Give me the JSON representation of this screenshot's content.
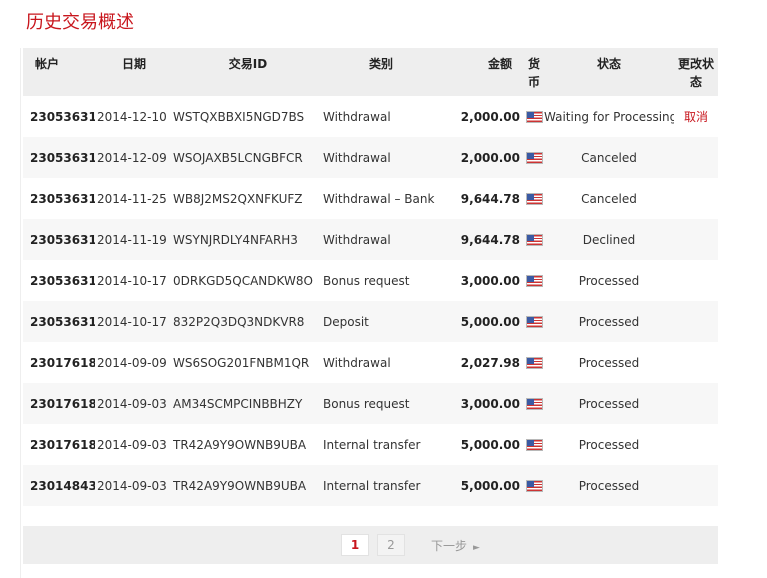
{
  "page": {
    "title": "历史交易概述"
  },
  "table": {
    "headers": {
      "account": "帐户",
      "date": "日期",
      "tx_id": "交易ID",
      "type": "类别",
      "amount": "金额",
      "currency": "货币",
      "status": "状态",
      "change_status": "更改状态"
    },
    "rows": [
      {
        "account": "23053631",
        "date": "2014-12-10",
        "tx_id": "WSTQXBBXI5NGD7BS",
        "type": "Withdrawal",
        "amount": "2,000.00",
        "currency_icon": "us-flag-icon",
        "status": "Waiting for Processing",
        "action": "取消"
      },
      {
        "account": "23053631",
        "date": "2014-12-09",
        "tx_id": "WSOJAXB5LCNGBFCR",
        "type": "Withdrawal",
        "amount": "2,000.00",
        "currency_icon": "us-flag-icon",
        "status": "Canceled",
        "action": ""
      },
      {
        "account": "23053631",
        "date": "2014-11-25",
        "tx_id": "WB8J2MS2QXNFKUFZ",
        "type": "Withdrawal – Bank",
        "amount": "9,644.78",
        "currency_icon": "us-flag-icon",
        "status": "Canceled",
        "action": ""
      },
      {
        "account": "23053631",
        "date": "2014-11-19",
        "tx_id": "WSYNJRDLY4NFARH3",
        "type": "Withdrawal",
        "amount": "9,644.78",
        "currency_icon": "us-flag-icon",
        "status": "Declined",
        "action": ""
      },
      {
        "account": "23053631",
        "date": "2014-10-17",
        "tx_id": "0DRKGD5QCANDKW8O",
        "type": "Bonus request",
        "amount": "3,000.00",
        "currency_icon": "us-flag-icon",
        "status": "Processed",
        "action": ""
      },
      {
        "account": "23053631",
        "date": "2014-10-17",
        "tx_id": "832P2Q3DQ3NDKVR8",
        "type": "Deposit",
        "amount": "5,000.00",
        "currency_icon": "us-flag-icon",
        "status": "Processed",
        "action": ""
      },
      {
        "account": "23017618",
        "date": "2014-09-09",
        "tx_id": "WS6SOG201FNBM1QR",
        "type": "Withdrawal",
        "amount": "2,027.98",
        "currency_icon": "us-flag-icon",
        "status": "Processed",
        "action": ""
      },
      {
        "account": "23017618",
        "date": "2014-09-03",
        "tx_id": "AM34SCMPCINBBHZY",
        "type": "Bonus request",
        "amount": "3,000.00",
        "currency_icon": "us-flag-icon",
        "status": "Processed",
        "action": ""
      },
      {
        "account": "23017618",
        "date": "2014-09-03",
        "tx_id": "TR42A9Y9OWNB9UBA",
        "type": "Internal transfer",
        "amount": "5,000.00",
        "currency_icon": "us-flag-icon",
        "status": "Processed",
        "action": ""
      },
      {
        "account": "23014843",
        "date": "2014-09-03",
        "tx_id": "TR42A9Y9OWNB9UBA",
        "type": "Internal transfer",
        "amount": "5,000.00",
        "currency_icon": "us-flag-icon",
        "status": "Processed",
        "action": ""
      }
    ]
  },
  "pagination": {
    "pages": [
      "1",
      "2"
    ],
    "current": "1",
    "next_label": "下一步"
  },
  "colors": {
    "accent": "#c8161d",
    "header_bg": "#eeeeee",
    "row_alt_bg": "#f7f7f7"
  }
}
